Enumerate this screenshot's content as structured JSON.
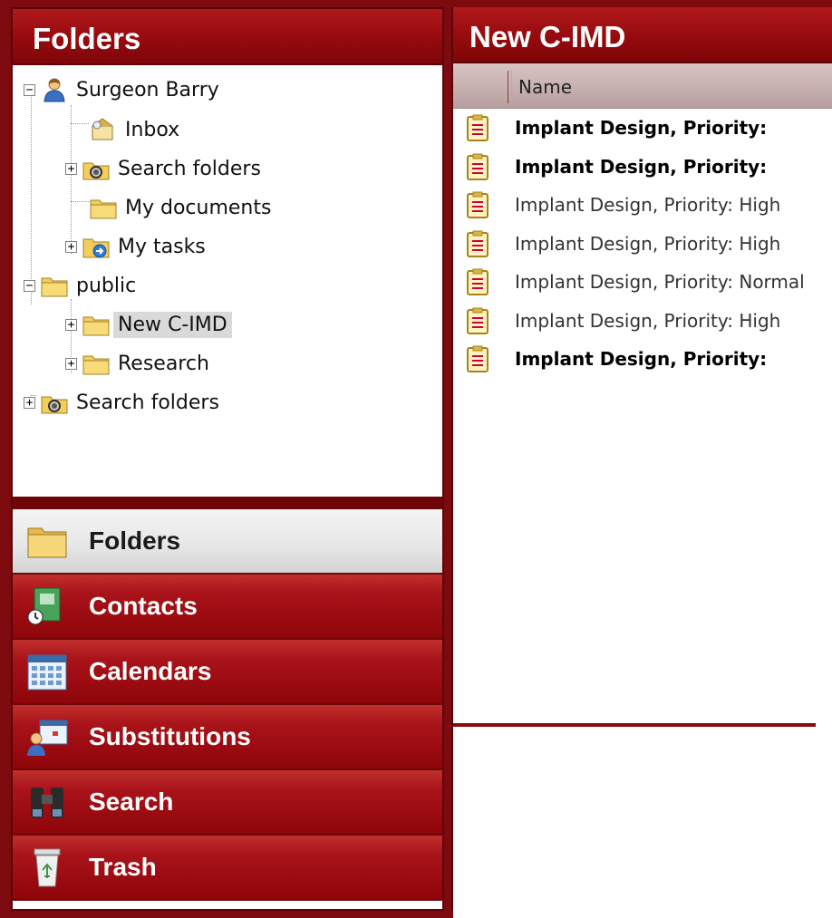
{
  "folders_panel": {
    "title": "Folders",
    "tree": [
      {
        "label": "Surgeon Barry",
        "icon": "user-icon",
        "expander": "−"
      },
      {
        "label": "Inbox",
        "icon": "inbox-icon"
      },
      {
        "label": "Search folders",
        "icon": "search-folder-icon",
        "expander": "+"
      },
      {
        "label": "My documents",
        "icon": "folder-icon"
      },
      {
        "label": "My tasks",
        "icon": "tasks-folder-icon",
        "expander": "+"
      },
      {
        "label": "public",
        "icon": "folder-icon",
        "expander": "−"
      },
      {
        "label": "New C-IMD",
        "icon": "folder-icon",
        "expander": "+",
        "selected": true
      },
      {
        "label": "Research",
        "icon": "folder-icon",
        "expander": "+"
      },
      {
        "label": "Search folders",
        "icon": "search-folder-icon",
        "expander": "+"
      }
    ]
  },
  "nav": {
    "items": [
      {
        "label": "Folders",
        "icon": "folder-icon",
        "active": true
      },
      {
        "label": "Contacts",
        "icon": "contacts-icon"
      },
      {
        "label": "Calendars",
        "icon": "calendar-icon"
      },
      {
        "label": "Substitutions",
        "icon": "substitutions-icon"
      },
      {
        "label": "Search",
        "icon": "binoculars-icon"
      },
      {
        "label": "Trash",
        "icon": "trash-icon"
      }
    ]
  },
  "list_panel": {
    "title": "New C-IMD",
    "column_name": "Name",
    "rows": [
      {
        "text": "Implant Design, Priority: ",
        "bold": true
      },
      {
        "text": "Implant Design, Priority: ",
        "bold": true
      },
      {
        "text": "Implant Design, Priority: High",
        "bold": false
      },
      {
        "text": "Implant Design, Priority: High",
        "bold": false
      },
      {
        "text": "Implant Design, Priority: Normal",
        "bold": false
      },
      {
        "text": "Implant Design, Priority: High",
        "bold": false
      },
      {
        "text": "Implant Design, Priority: ",
        "bold": true
      }
    ]
  },
  "colors": {
    "brand_red": "#9b0c10",
    "dark_red": "#6e0609",
    "selection_gray": "#d9d9d9"
  }
}
